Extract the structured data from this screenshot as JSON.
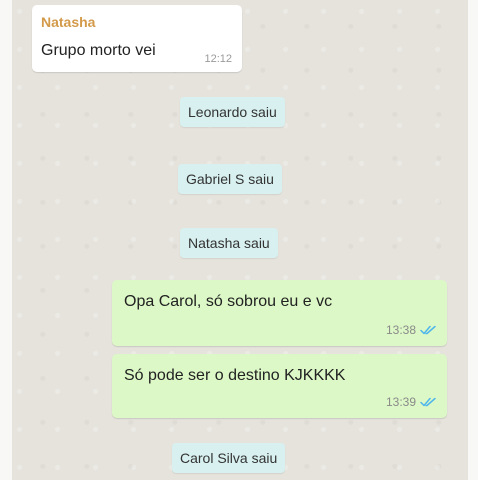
{
  "chat": {
    "incoming": {
      "sender": "Natasha",
      "text": "Grupo morto vei",
      "time": "12:12"
    },
    "notices": [
      "Leonardo saiu",
      "Gabriel S saiu",
      "Natasha saiu",
      "Carol Silva saiu"
    ],
    "outgoing": [
      {
        "text": "Opa Carol, só sobrou eu e vc",
        "time": "13:38",
        "status_icon": "double-check-icon"
      },
      {
        "text": "Só pode ser o destino KJKKKK",
        "time": "13:39",
        "status_icon": "double-check-icon"
      }
    ]
  },
  "colors": {
    "chat_background": "#e5e3dc",
    "incoming_bubble": "#ffffff",
    "outgoing_bubble": "#dcf8c6",
    "notice_bubble": "#d8f0f0",
    "sender_name": "#d39a4a",
    "read_ticks": "#4fb6ec"
  }
}
